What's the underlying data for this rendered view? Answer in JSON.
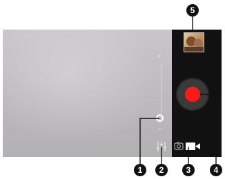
{
  "zoom": {
    "plus_label": "+",
    "minus_label": "−",
    "level": 0.05
  },
  "icons": {
    "settings": "sliders-icon",
    "mode_switch": "camera-video-switch-icon",
    "record": "record-icon",
    "thumbnail": "gallery-thumbnail"
  },
  "colors": {
    "record": "#ff1a1a",
    "panel": "#111111",
    "callout": "#111111"
  },
  "callouts": [
    "1",
    "2",
    "3",
    "4",
    "5"
  ]
}
